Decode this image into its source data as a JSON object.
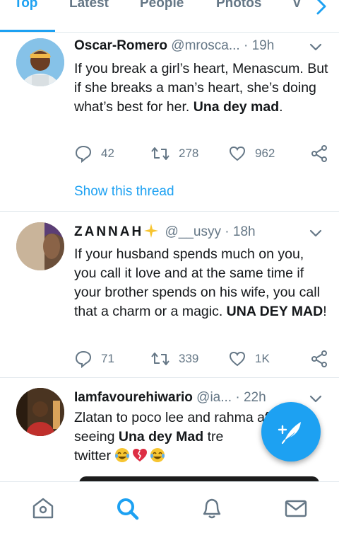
{
  "tabs": [
    {
      "label": "Top",
      "active": true
    },
    {
      "label": "Latest",
      "active": false
    },
    {
      "label": "People",
      "active": false
    },
    {
      "label": "Photos",
      "active": false
    },
    {
      "label": "V",
      "active": false
    }
  ],
  "tweets": [
    {
      "display_name": "Oscar-Romero",
      "handle": "@mrosca...",
      "separator": "·",
      "time": "19h",
      "text_main": "If you break a girl’s heart, Menascum. But if she breaks a man’s heart, she’s doing what’s best for her. ",
      "text_bold": "Una dey mad",
      "text_end": ".",
      "replies": "42",
      "retweets": "278",
      "likes": "962",
      "thread_link": "Show this thread"
    },
    {
      "display_name": "ZANNAH",
      "handle": "@__usyy",
      "separator": "·",
      "time": "18h",
      "text_main": "If your husband spends much on you, you call it love and at the same time if your brother spends on his wife, you call that a charm or a magic. ",
      "text_bold": "UNA DEY MAD",
      "text_end": "!",
      "replies": "71",
      "retweets": "339",
      "likes": "1K"
    },
    {
      "display_name": "Iamfavourehiwario",
      "handle": "@ia...",
      "separator": "·",
      "time": "22h",
      "text_main": "Zlatan to poco lee and rahma after seeing ",
      "text_bold": "Una dey Mad",
      "text_end": " tre",
      "text_tail": "twitter"
    }
  ],
  "colors": {
    "accent": "#1da1f2",
    "secondary_text": "#657786",
    "primary_text": "#14171a",
    "divider": "#e1e8ed"
  },
  "icons": {
    "tab_scroll": "chevron-right-icon",
    "caret": "chevron-down-icon",
    "reply": "reply-icon",
    "retweet": "retweet-icon",
    "like": "heart-icon",
    "share": "share-icon",
    "compose": "compose-tweet-icon",
    "nav": [
      "home-icon",
      "search-icon",
      "notifications-icon",
      "messages-icon"
    ],
    "sparkle": "sparkles-emoji",
    "emoji_laugh": "tears-of-joy-emoji",
    "emoji_broken_heart": "broken-heart-emoji"
  }
}
